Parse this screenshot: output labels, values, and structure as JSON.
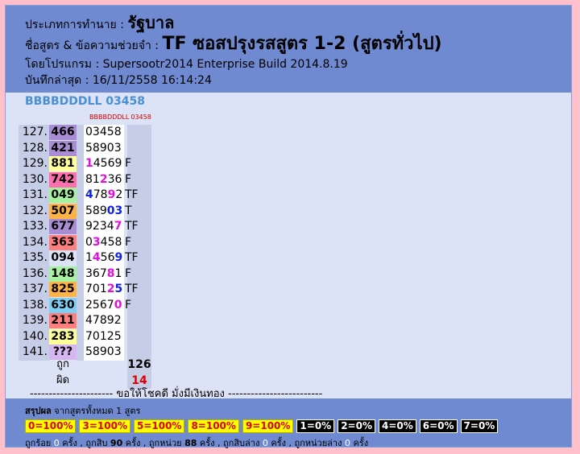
{
  "header": {
    "type_label": "ประเภทการทำนาย : ",
    "type_value": "รัฐบาล",
    "formula_label": "ชื่อสูตร & ข้อความช่วยจำ : ",
    "formula_value": "TF ซอสปรุงรสสูตร 1-2 (สูตรทั่วไป)",
    "program": "โดยโปรแกรม : Supersootr2014 Enterprise Build 2014.8.19",
    "saved": "บันทึกล่าสุด : 16/11/2558 16:14:24"
  },
  "code_title": "BBBBDDDLL 03458",
  "subheader": {
    "a": "BBBBDDDLL",
    "b": "03458"
  },
  "colors": {
    "purple": "#a98cd4",
    "yellow": "#ffff99",
    "pink": "#ff6fb0",
    "green": "#a6f0a0",
    "orange": "#ffb347",
    "salmon": "#ff7f7f",
    "blue": "#7fcff5",
    "lilac": "#d5b6f0"
  },
  "rows": [
    {
      "no": "127.",
      "res": "466",
      "color": "#a98cd4",
      "fml": [
        [
          "0",
          ""
        ],
        [
          "3",
          ""
        ],
        [
          "4",
          ""
        ],
        [
          "5",
          ""
        ],
        [
          "8",
          ""
        ]
      ],
      "mark": ""
    },
    {
      "no": "128.",
      "res": "421",
      "color": "#a98cd4",
      "fml": [
        [
          "5",
          ""
        ],
        [
          "8",
          ""
        ],
        [
          "9",
          ""
        ],
        [
          "0",
          ""
        ],
        [
          "3",
          ""
        ]
      ],
      "mark": ""
    },
    {
      "no": "129.",
      "res": "881",
      "color": "#ffff99",
      "fml": [
        [
          "1",
          "m"
        ],
        [
          "4",
          ""
        ],
        [
          "5",
          ""
        ],
        [
          "6",
          ""
        ],
        [
          "9",
          ""
        ]
      ],
      "mark": "F"
    },
    {
      "no": "130.",
      "res": "742",
      "color": "#ff6fb0",
      "fml": [
        [
          "8",
          ""
        ],
        [
          "1",
          ""
        ],
        [
          "2",
          "m"
        ],
        [
          "3",
          ""
        ],
        [
          "6",
          ""
        ]
      ],
      "mark": "F"
    },
    {
      "no": "131.",
      "res": "049",
      "color": "#a6f0a0",
      "fml": [
        [
          "4",
          "b"
        ],
        [
          "7",
          ""
        ],
        [
          "8",
          ""
        ],
        [
          "9",
          "m"
        ],
        [
          "2",
          ""
        ]
      ],
      "mark": "TF"
    },
    {
      "no": "132.",
      "res": "507",
      "color": "#ffb347",
      "fml": [
        [
          "5",
          ""
        ],
        [
          "8",
          ""
        ],
        [
          "9",
          ""
        ],
        [
          "0",
          "b"
        ],
        [
          "3",
          "b"
        ]
      ],
      "mark": "T"
    },
    {
      "no": "133.",
      "res": "677",
      "color": "#a98cd4",
      "fml": [
        [
          "9",
          ""
        ],
        [
          "2",
          ""
        ],
        [
          "3",
          ""
        ],
        [
          "4",
          ""
        ],
        [
          "7",
          "m"
        ]
      ],
      "mark": "TF"
    },
    {
      "no": "134.",
      "res": "363",
      "color": "#ff7f7f",
      "fml": [
        [
          "0",
          ""
        ],
        [
          "3",
          "m"
        ],
        [
          "4",
          ""
        ],
        [
          "5",
          ""
        ],
        [
          "8",
          ""
        ]
      ],
      "mark": "F"
    },
    {
      "no": "135.",
      "res": "094",
      "color": "#dde3f7",
      "fml": [
        [
          "1",
          ""
        ],
        [
          "4",
          "m"
        ],
        [
          "5",
          ""
        ],
        [
          "6",
          ""
        ],
        [
          "9",
          "b"
        ]
      ],
      "mark": "TF"
    },
    {
      "no": "136.",
      "res": "148",
      "color": "#a6f0a0",
      "fml": [
        [
          "3",
          ""
        ],
        [
          "6",
          ""
        ],
        [
          "7",
          ""
        ],
        [
          "8",
          "m"
        ],
        [
          "1",
          ""
        ]
      ],
      "mark": "F"
    },
    {
      "no": "137.",
      "res": "825",
      "color": "#ffb347",
      "fml": [
        [
          "7",
          ""
        ],
        [
          "0",
          ""
        ],
        [
          "1",
          ""
        ],
        [
          "2",
          "m"
        ],
        [
          "5",
          "b"
        ]
      ],
      "mark": "TF"
    },
    {
      "no": "138.",
      "res": "630",
      "color": "#7fcff5",
      "fml": [
        [
          "2",
          ""
        ],
        [
          "5",
          ""
        ],
        [
          "6",
          ""
        ],
        [
          "7",
          ""
        ],
        [
          "0",
          "m"
        ]
      ],
      "mark": "F"
    },
    {
      "no": "139.",
      "res": "211",
      "color": "#ff7f7f",
      "fml": [
        [
          "4",
          ""
        ],
        [
          "7",
          ""
        ],
        [
          "8",
          ""
        ],
        [
          "9",
          ""
        ],
        [
          "2",
          ""
        ]
      ],
      "mark": ""
    },
    {
      "no": "140.",
      "res": "283",
      "color": "#ffff99",
      "fml": [
        [
          "7",
          ""
        ],
        [
          "0",
          ""
        ],
        [
          "1",
          ""
        ],
        [
          "2",
          ""
        ],
        [
          "5",
          ""
        ]
      ],
      "mark": ""
    },
    {
      "no": "141.",
      "res": "???",
      "color": "#d5b6f0",
      "fml": [
        [
          "5",
          ""
        ],
        [
          "8",
          ""
        ],
        [
          "9",
          ""
        ],
        [
          "0",
          ""
        ],
        [
          "3",
          ""
        ]
      ],
      "mark": ""
    }
  ],
  "summary": {
    "right_label": "ถูก",
    "right_value": "126",
    "wrong_label": "ผิด",
    "wrong_value": "14"
  },
  "wish": "---------------------- ขอให้โชคดี มั่งมีเงินทอง -------------------------",
  "footer": {
    "summary_label": "สรุปผล",
    "summary_text": " จากสูตรทั้งหมด 1 สูตร",
    "badges": [
      {
        "text": "0=100%",
        "style": "y"
      },
      {
        "text": "3=100%",
        "style": "y"
      },
      {
        "text": "5=100%",
        "style": "y"
      },
      {
        "text": "8=100%",
        "style": "y"
      },
      {
        "text": "9=100%",
        "style": "y"
      },
      {
        "text": "1=0%",
        "style": "k"
      },
      {
        "text": "2=0%",
        "style": "k"
      },
      {
        "text": "4=0%",
        "style": "k"
      },
      {
        "text": "6=0%",
        "style": "k"
      },
      {
        "text": "7=0%",
        "style": "k"
      }
    ],
    "stats": [
      {
        "t": "ถูกร้อย ",
        "v": "0",
        "c": "n"
      },
      {
        "t": " ครั้ง , ถูกสิบ ",
        "v": "90",
        "c": "b"
      },
      {
        "t": " ครั้ง , ถูกหน่วย ",
        "v": "88",
        "c": "b"
      },
      {
        "t": " ครั้ง , ถูกสิบล่าง ",
        "v": "0",
        "c": "n"
      },
      {
        "t": " ครั้ง , ถูกหน่วยล่าง ",
        "v": "0",
        "c": "n"
      },
      {
        "t": " ครั้ง",
        "v": "",
        "c": ""
      }
    ]
  }
}
